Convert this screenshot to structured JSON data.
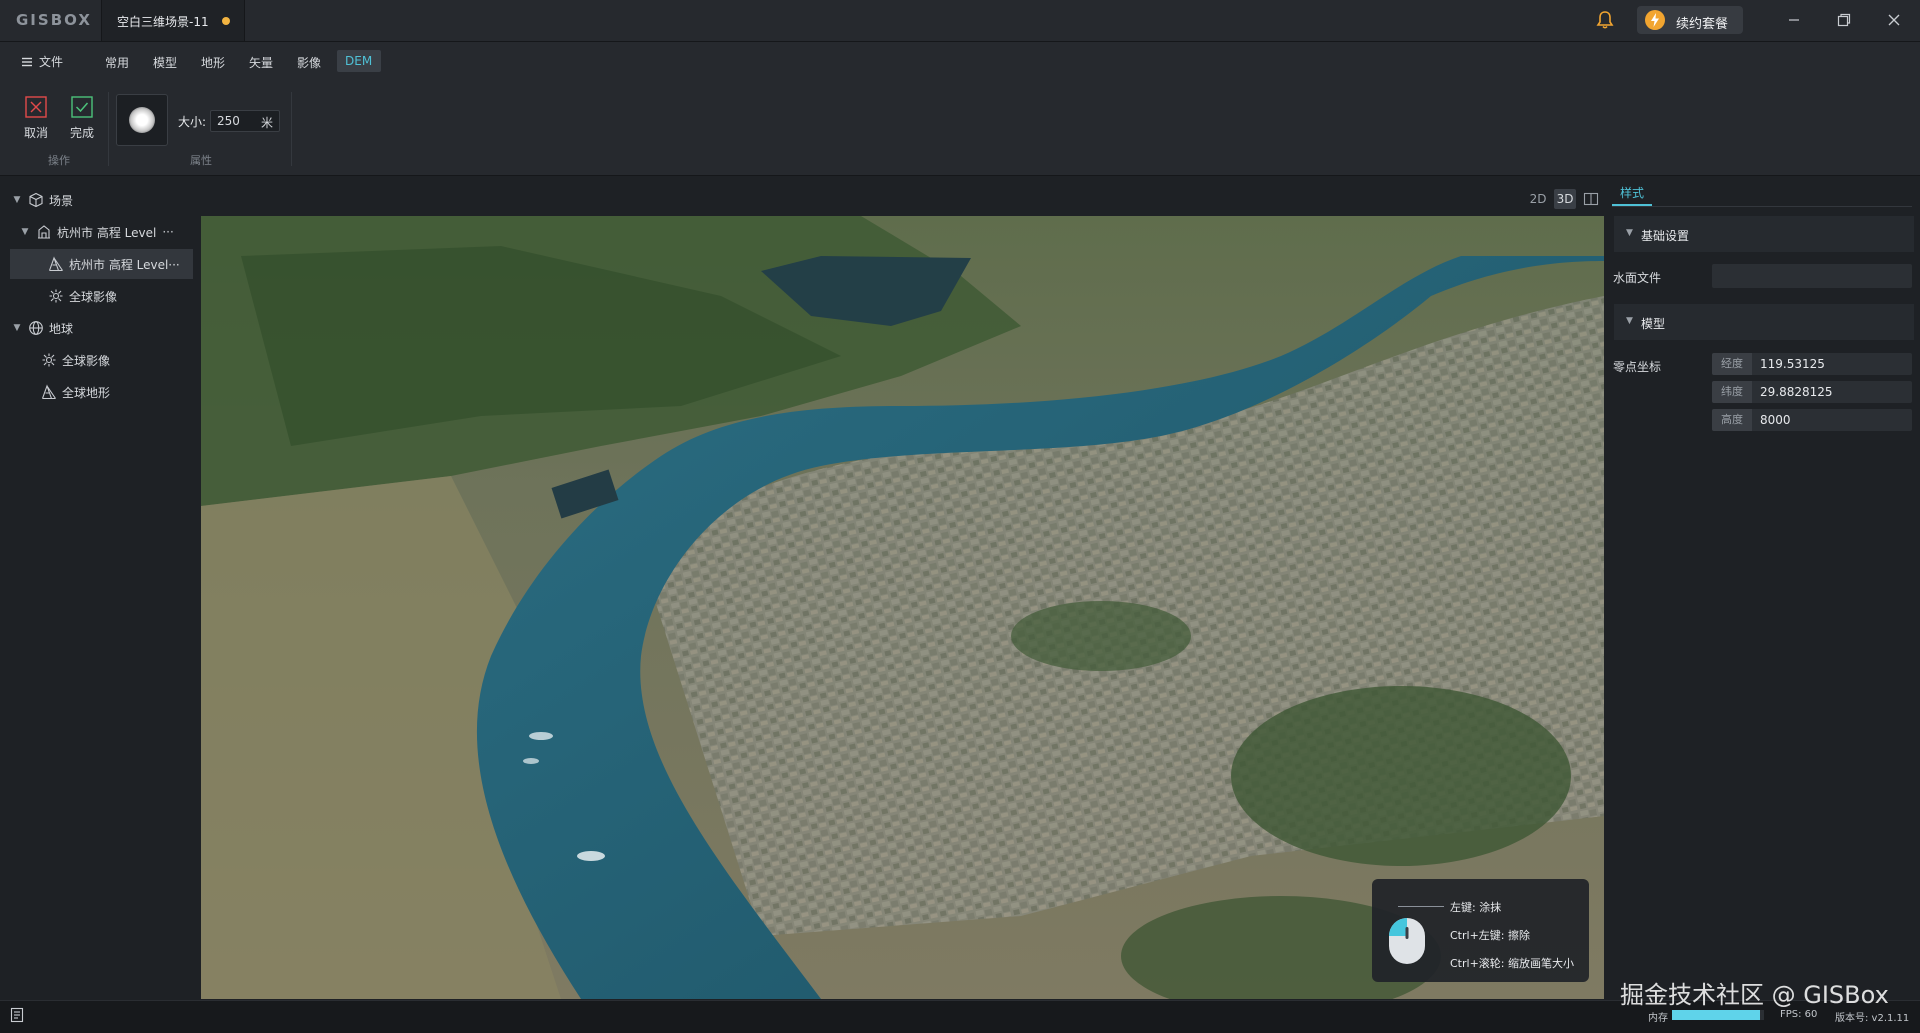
{
  "app": {
    "logo": "GISBOX"
  },
  "document_tab": {
    "title": "空白三维场景-11",
    "unsaved_color": "#f2b441"
  },
  "header": {
    "renew_label": "续约套餐"
  },
  "menu": {
    "file_label": "文件",
    "tabs": [
      "常用",
      "模型",
      "地形",
      "矢量",
      "影像",
      "DEM"
    ],
    "active_tab": "DEM"
  },
  "ribbon": {
    "cancel_label": "取消",
    "done_label": "完成",
    "group_operation": "操作",
    "group_property": "属性",
    "size_label": "大小:",
    "size_value": "250",
    "size_unit": "米"
  },
  "scene_tree": {
    "root_label": "场景",
    "items": [
      {
        "label": "杭州市 高程 Level",
        "more": "···",
        "icon": "building-icon"
      },
      {
        "label": "杭州市 高程 Level···",
        "icon": "terrain-icon"
      },
      {
        "label": "全球影像",
        "icon": "imagery-icon"
      }
    ],
    "globe_label": "地球",
    "globe_items": [
      {
        "label": "全球影像",
        "icon": "imagery-icon"
      },
      {
        "label": "全球地形",
        "icon": "terrain-icon"
      }
    ]
  },
  "view_modes": [
    "2D",
    "3D"
  ],
  "active_view_mode": "3D",
  "hints": {
    "left_click": "左键: 涂抹",
    "ctrl_left": "Ctrl+左键: 擦除",
    "ctrl_wheel": "Ctrl+滚轮: 缩放画笔大小"
  },
  "properties": {
    "tab_label": "样式",
    "basic_section": "基础设置",
    "water_file_label": "水面文件",
    "water_file_value": "",
    "model_section": "模型",
    "origin_label": "零点坐标",
    "longitude_key": "经度",
    "longitude_value": "119.53125",
    "latitude_key": "纬度",
    "latitude_value": "29.8828125",
    "height_key": "高度",
    "height_value": "8000"
  },
  "status": {
    "memory_label": "内存",
    "memory_fraction": 0.96,
    "fps_label": "FPS: 60",
    "version_label": "版本号: v2.1.11"
  },
  "watermark": "掘金技术社区 @ GISBox",
  "colors": {
    "accent": "#4fc1d6",
    "renew": "#f2a530",
    "river": "#1f5a6e"
  }
}
